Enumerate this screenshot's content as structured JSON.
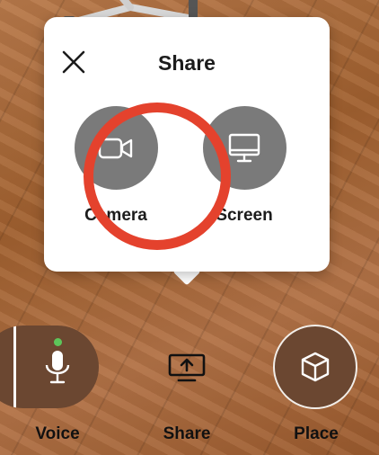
{
  "popup": {
    "title": "Share",
    "options": [
      {
        "label": "Camera",
        "icon": "video-camera-icon"
      },
      {
        "label": "Screen",
        "icon": "monitor-icon"
      }
    ],
    "highlighted_option": "Camera"
  },
  "toolbar": {
    "voice_label": "Voice",
    "share_label": "Share",
    "place_label": "Place",
    "voice_active": true
  },
  "colors": {
    "option_circle": "#7a7a7a",
    "highlight_ring": "#e4422d",
    "active_dot": "#5dc55a",
    "control_bg": "#6b4731"
  }
}
